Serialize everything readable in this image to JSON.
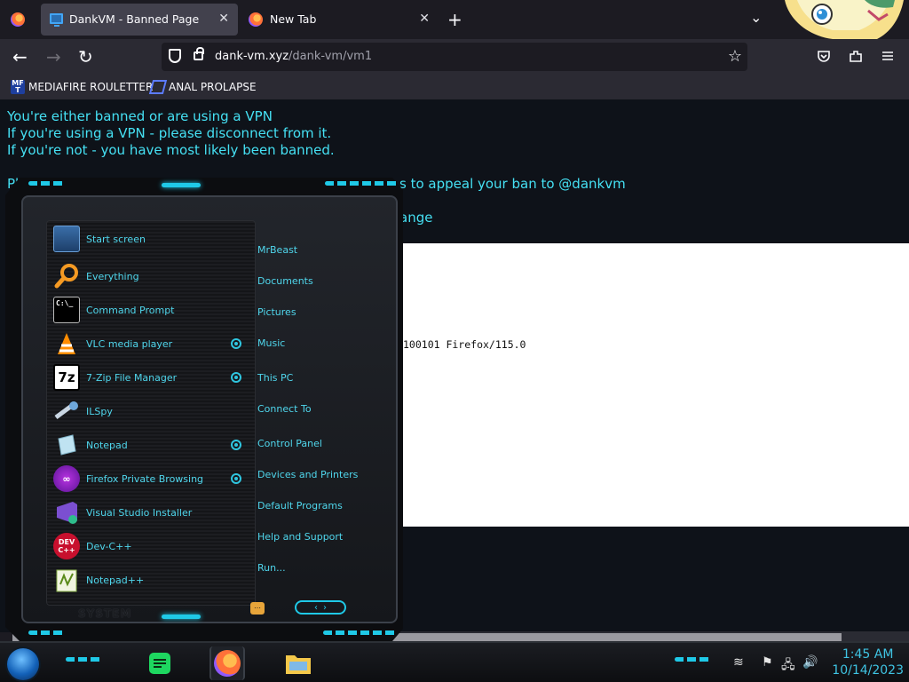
{
  "tabs": [
    {
      "title": "DankVM - Banned Page",
      "active": true
    },
    {
      "title": "New Tab",
      "active": false
    }
  ],
  "toolbar": {
    "new_tab": "+",
    "list_tabs": "⌄",
    "back": "←",
    "forward": "→",
    "reload": "↻",
    "bookmark_star": "☆"
  },
  "url": {
    "host": "dank-vm.xyz",
    "path": "/dank-vm/vm1"
  },
  "bookmarks": [
    {
      "label": "MEDIAFIRE ROULETTER",
      "icon_text": "MF T"
    },
    {
      "label": "ANAL PROLAPSE"
    }
  ],
  "page": {
    "line1": "You're either banned or are using a VPN",
    "line2": "If you're using a VPN - please disconnect from it.",
    "line3": "If you're not - you have most likely been banned.",
    "line4_start": "Pl",
    "line4_end": "s to appeal your ban to @dankvm",
    "line5_fragment": "ange",
    "ua_fragment": "100101 Firefox/115.0"
  },
  "start_menu": {
    "programs": [
      {
        "label": "Start screen",
        "icon": "start-screen-icon"
      },
      {
        "label": "Everything",
        "icon": "search-magnifier-icon"
      },
      {
        "label": "Command Prompt",
        "icon": "command-prompt-icon",
        "icon_text": "C:\\_"
      },
      {
        "label": "VLC media player",
        "icon": "vlc-cone-icon",
        "pinned": true
      },
      {
        "label": "7-Zip File Manager",
        "icon": "seven-zip-icon",
        "icon_text": "7z",
        "pinned": true
      },
      {
        "label": "ILSpy",
        "icon": "ilspy-icon"
      },
      {
        "label": "Notepad",
        "icon": "notepad-icon",
        "pinned": true
      },
      {
        "label": "Firefox Private Browsing",
        "icon": "firefox-private-icon",
        "pinned": true
      },
      {
        "label": "Visual Studio Installer",
        "icon": "visual-studio-icon"
      },
      {
        "label": "Dev-C++",
        "icon": "dev-cpp-icon",
        "icon_text": "DEV C++"
      },
      {
        "label": "Notepad++",
        "icon": "notepad-plus-plus-icon"
      }
    ],
    "places": [
      "MrBeast",
      "Documents",
      "Pictures",
      "Music",
      "This PC",
      "Connect To",
      "Control Panel",
      "Devices and Printers",
      "Default Programs",
      "Help and Support",
      "Run..."
    ],
    "system_label": "SYSTEM"
  },
  "taskbar": {
    "clock_time": "1:45 AM",
    "clock_date": "10/14/2023"
  },
  "colors": {
    "accent": "#45e0f3",
    "chrome_bg": "#2b2a33",
    "page_bg": "#0e1219"
  }
}
